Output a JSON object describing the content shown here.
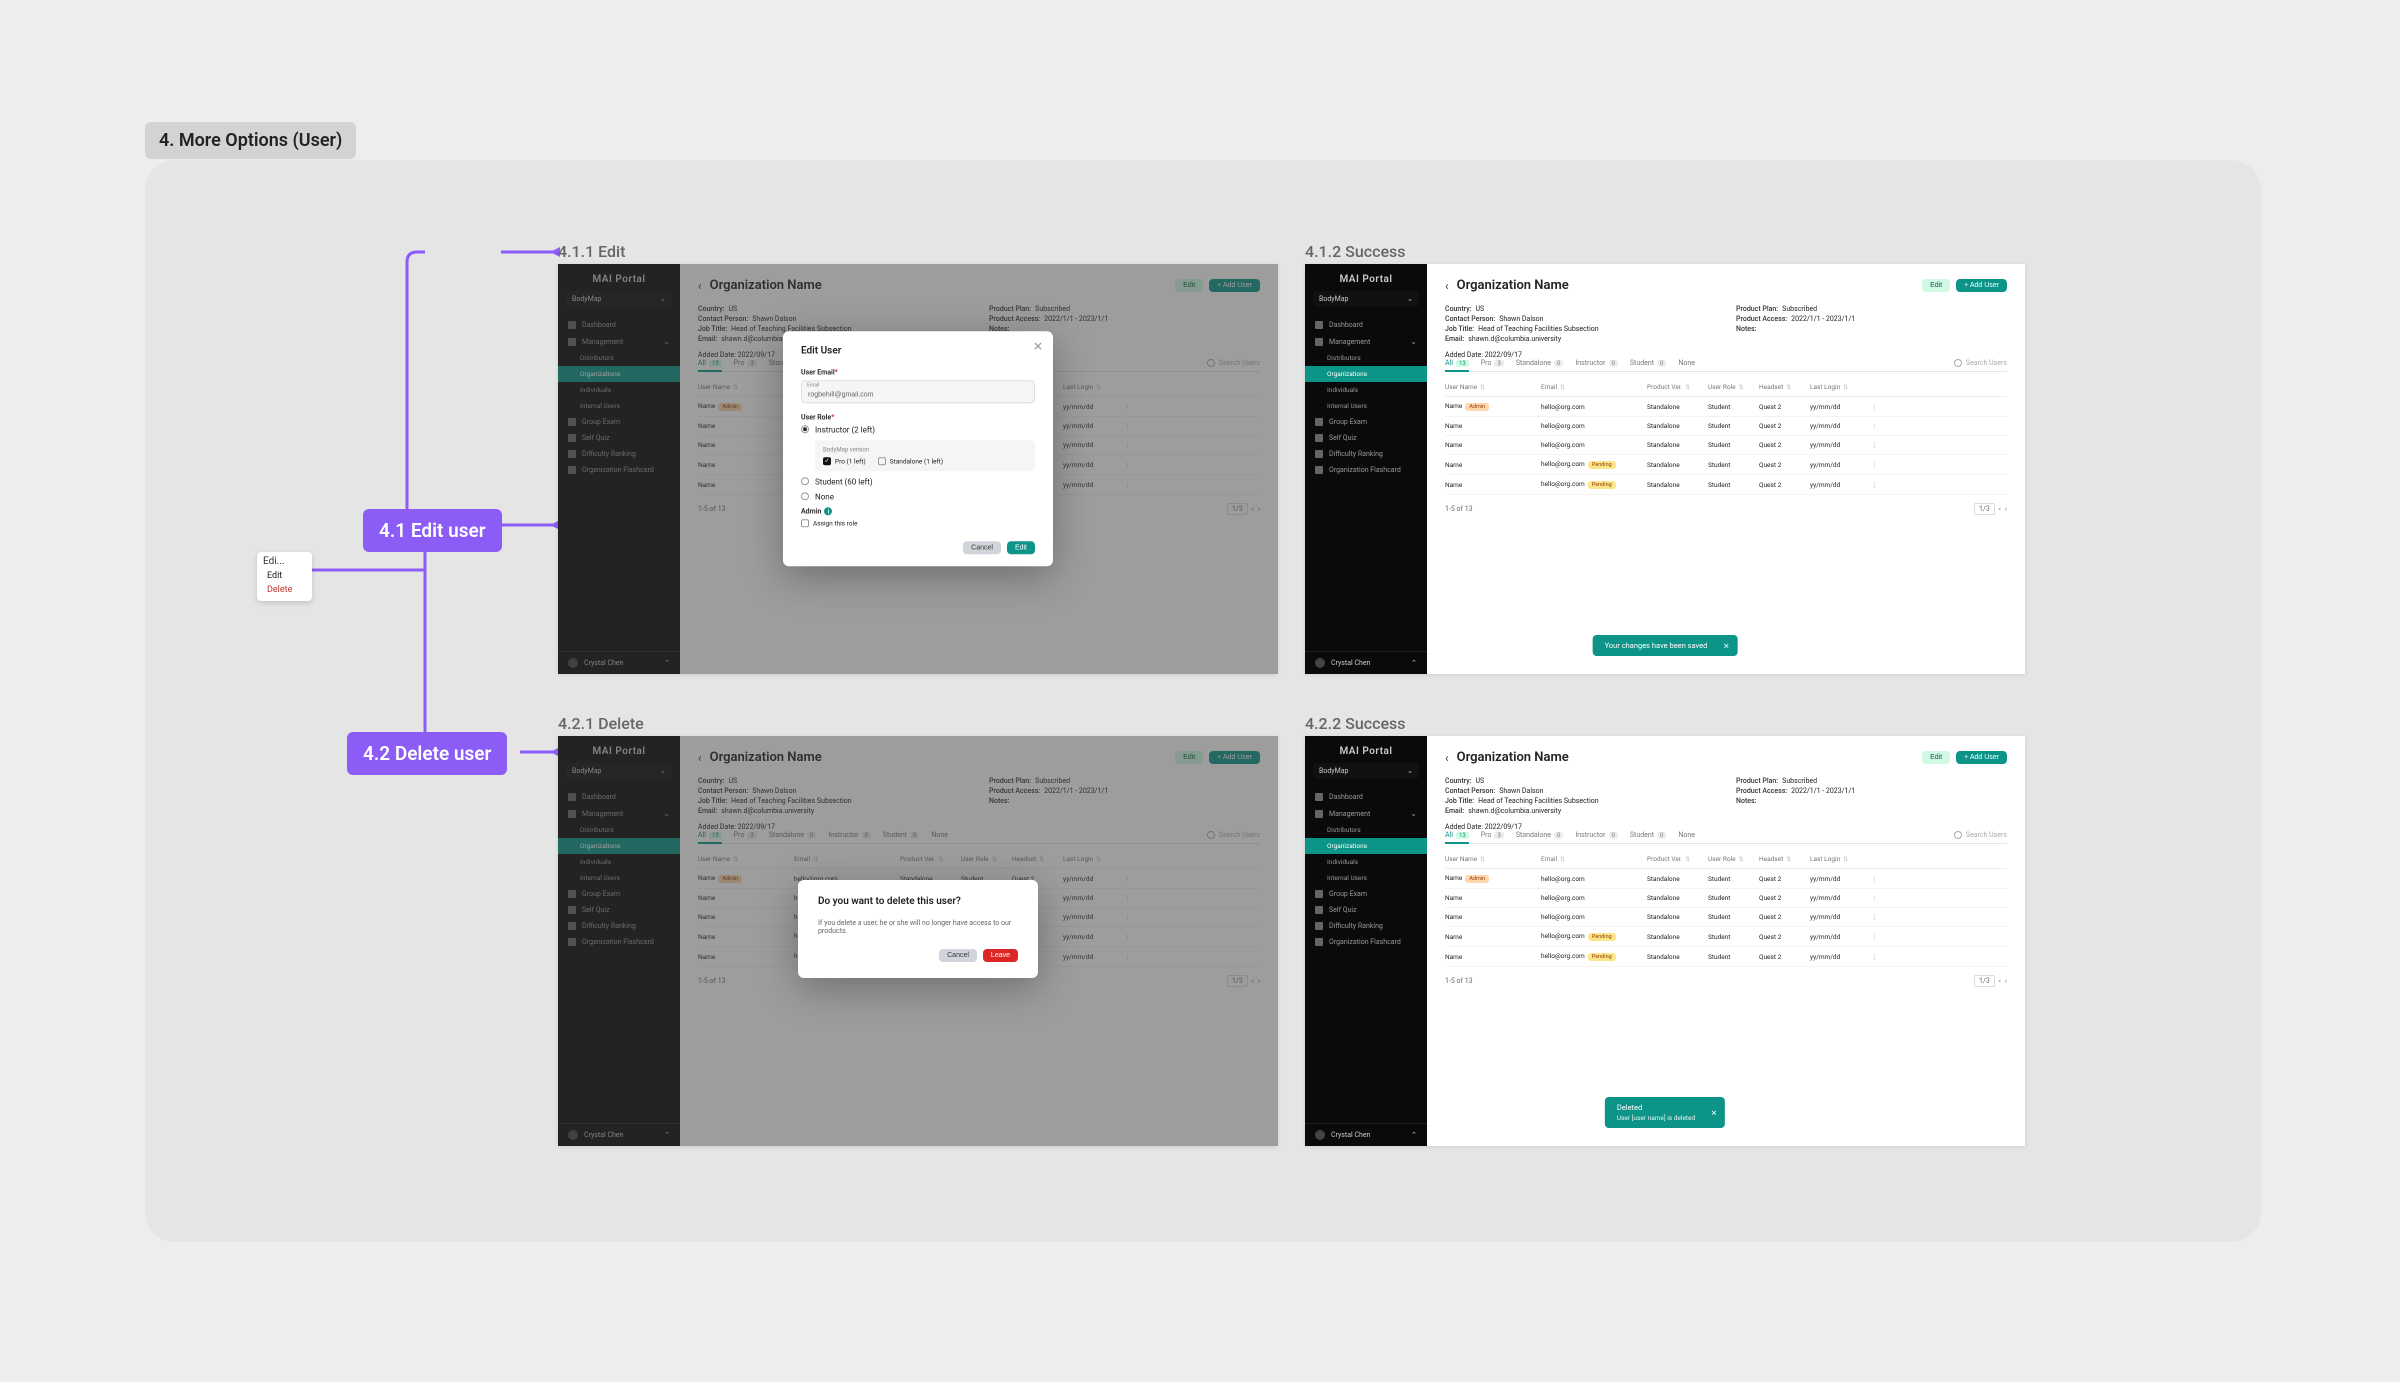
{
  "section_tag": "4. More Options (User)",
  "ann": {
    "node_title": "Edi...",
    "edit": "Edit",
    "delete": "Delete",
    "label_edit": "4.1 Edit user",
    "label_delete": "4.2 Delete user"
  },
  "titles": {
    "s411": "4.1.1 Edit",
    "s412": "4.1.2 Success",
    "s421": "4.2.1 Delete",
    "s422": "4.2.2 Success"
  },
  "sidebar": {
    "brand": "MAI Portal",
    "product": "BodyMap",
    "items": [
      {
        "label": "Dashboard"
      },
      {
        "label": "Management",
        "chev": true
      },
      {
        "label": "Distributors",
        "sub": true
      },
      {
        "label": "Organizations",
        "sub": true,
        "active": true
      },
      {
        "label": "Individuals",
        "sub": true
      },
      {
        "label": "Internal Users",
        "sub": true
      },
      {
        "label": "Group Exam"
      },
      {
        "label": "Self Quiz"
      },
      {
        "label": "Difficulty Ranking"
      },
      {
        "label": "Organization Flashcard"
      }
    ],
    "user": "Crystal Chen"
  },
  "org": {
    "title": "Organization Name",
    "back": "‹",
    "edit_btn": "Edit",
    "add_btn": "+  Add User",
    "meta": {
      "country_k": "Country:",
      "country_v": "US",
      "contact_k": "Contact Person:",
      "contact_v": "Shawn Dalson",
      "title_k": "Job Title:",
      "title_v": "Head of Teaching Facilities Subsection",
      "email_k": "Email:",
      "email_v": "shawn.d@columbia.university",
      "plan_k": "Product Plan:",
      "plan_v": "Subscribed",
      "access_k": "Product Access:",
      "access_v": "2022/1/1 - 2023/1/1",
      "notes_k": "Notes:",
      "added_k": "Added Date:",
      "added_v": "2022/09/17"
    },
    "tabs": [
      {
        "label": "All",
        "count": "13",
        "active": true
      },
      {
        "label": "Pro",
        "count": "3"
      },
      {
        "label": "Standalone",
        "count": "0"
      },
      {
        "label": "Instructor",
        "count": "0"
      },
      {
        "label": "Student",
        "count": "0"
      },
      {
        "label": "None",
        "count": ""
      }
    ],
    "search_ph": "Search Users",
    "cols": [
      "User Name",
      "Email",
      "Product Ver.",
      "User Role",
      "Headset",
      "Last Login"
    ],
    "sort_glyph": "⇅",
    "rows": [
      {
        "name": "Name",
        "badge": "Admin",
        "email": "hello@org.com",
        "ver": "Standalone",
        "role": "Student",
        "hs": "Quest 2",
        "login": "yy/mm/dd"
      },
      {
        "name": "Name",
        "email": "hello@org.com",
        "ver": "Standalone",
        "role": "Student",
        "hs": "Quest 2",
        "login": "yy/mm/dd"
      },
      {
        "name": "Name",
        "email": "hello@org.com",
        "ver": "Standalone",
        "role": "Student",
        "hs": "Quest 2",
        "login": "yy/mm/dd"
      },
      {
        "name": "Name",
        "email": "hello@org.com",
        "pend": "Pending",
        "ver": "Standalone",
        "role": "Student",
        "hs": "Quest 2",
        "login": "yy/mm/dd"
      },
      {
        "name": "Name",
        "email": "hello@org.com",
        "pend": "Pending",
        "ver": "Standalone",
        "role": "Student",
        "hs": "Quest 2",
        "login": "yy/mm/dd"
      }
    ],
    "pager_info": "1-5 of 13",
    "pager_cur": "1/3",
    "pager_prev": "‹",
    "pager_next": "›"
  },
  "edit_modal": {
    "title": "Edit User",
    "email_lbl": "User Email",
    "email_float": "Email",
    "email_val": "rogbehill@gmail.com",
    "role_lbl": "User Role",
    "r_instructor": "Instructor (2 left)",
    "sub_title": "BodyMap version",
    "chk_pro": "Pro (1 left)",
    "chk_sa": "Standalone (1 left)",
    "r_student": "Student (60 left)",
    "r_none": "None",
    "admin_lbl": "Admin",
    "chk_assign": "Assign this role",
    "cancel": "Cancel",
    "save": "Edit"
  },
  "del_modal": {
    "title": "Do you want to delete this user?",
    "body": "If you delete a user, he or she will no longer have access to our products.",
    "cancel": "Cancel",
    "leave": "Leave"
  },
  "toast_save": "Your changes have been saved",
  "toast_del_title": "Deleted",
  "toast_del_body": "User [user name] is deleted",
  "toast_close": "✕"
}
